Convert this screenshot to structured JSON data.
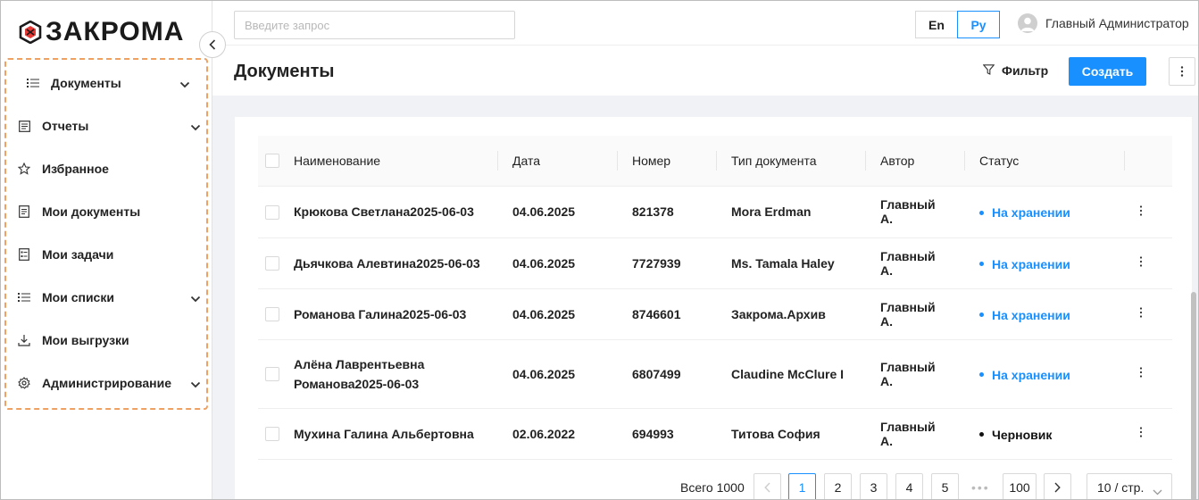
{
  "brand": {
    "name": "ЗАКРОМА",
    "logo_icon": "hexagon-logo-icon",
    "accent": "#e53935"
  },
  "sidebar": {
    "collapse_icon": "chevron-left-icon",
    "items": [
      {
        "label": "Документы",
        "icon": "list-icon",
        "expandable": true
      },
      {
        "label": "Отчеты",
        "icon": "report-icon",
        "expandable": true
      },
      {
        "label": "Избранное",
        "icon": "star-icon",
        "expandable": false
      },
      {
        "label": "Мои документы",
        "icon": "document-icon",
        "expandable": false
      },
      {
        "label": "Мои задачи",
        "icon": "tasks-icon",
        "expandable": false
      },
      {
        "label": "Мои списки",
        "icon": "list-icon",
        "expandable": true
      },
      {
        "label": "Мои выгрузки",
        "icon": "download-icon",
        "expandable": false
      },
      {
        "label": "Администрирование",
        "icon": "gear-icon",
        "expandable": true
      }
    ]
  },
  "topbar": {
    "search_placeholder": "Введите запрос",
    "lang_en": "En",
    "lang_ru": "Ру",
    "active_lang": "Ру",
    "user_name": "Главный Администратор"
  },
  "page": {
    "title": "Документы",
    "filter_label": "Фильтр",
    "create_label": "Создать"
  },
  "table": {
    "columns": [
      "Наименование",
      "Дата",
      "Номер",
      "Тип документа",
      "Автор",
      "Статус"
    ],
    "rows": [
      {
        "name": "Крюкова Светлана2025-06-03",
        "date": "04.06.2025",
        "number": "821378",
        "type": "Mora Erdman",
        "author": "Главный А.",
        "status": "На хранении",
        "status_color": "#1890ff"
      },
      {
        "name": "Дьячкова Алевтина2025-06-03",
        "date": "04.06.2025",
        "number": "7727939",
        "type": "Ms. Tamala Haley",
        "author": "Главный А.",
        "status": "На хранении",
        "status_color": "#1890ff"
      },
      {
        "name": "Романова Галина2025-06-03",
        "date": "04.06.2025",
        "number": "8746601",
        "type": "Закрома.Архив",
        "author": "Главный А.",
        "status": "На хранении",
        "status_color": "#1890ff"
      },
      {
        "name_line1": "Алёна Лаврентьевна",
        "name_line2": "Романова2025-06-03",
        "date": "04.06.2025",
        "number": "6807499",
        "type": "Claudine McClure I",
        "author": "Главный А.",
        "status": "На хранении",
        "status_color": "#1890ff"
      },
      {
        "name": "Мухина Галина Альбертовна",
        "date": "02.06.2022",
        "number": "694993",
        "type": "Титова София",
        "author": "Главный А.",
        "status": "Черновик",
        "status_color": "#111111"
      }
    ]
  },
  "pagination": {
    "total_label": "Всего 1000",
    "pages": [
      "1",
      "2",
      "3",
      "4",
      "5"
    ],
    "ellipsis": "•••",
    "last_page": "100",
    "current_page": "1",
    "per_page": "10 / стр."
  }
}
